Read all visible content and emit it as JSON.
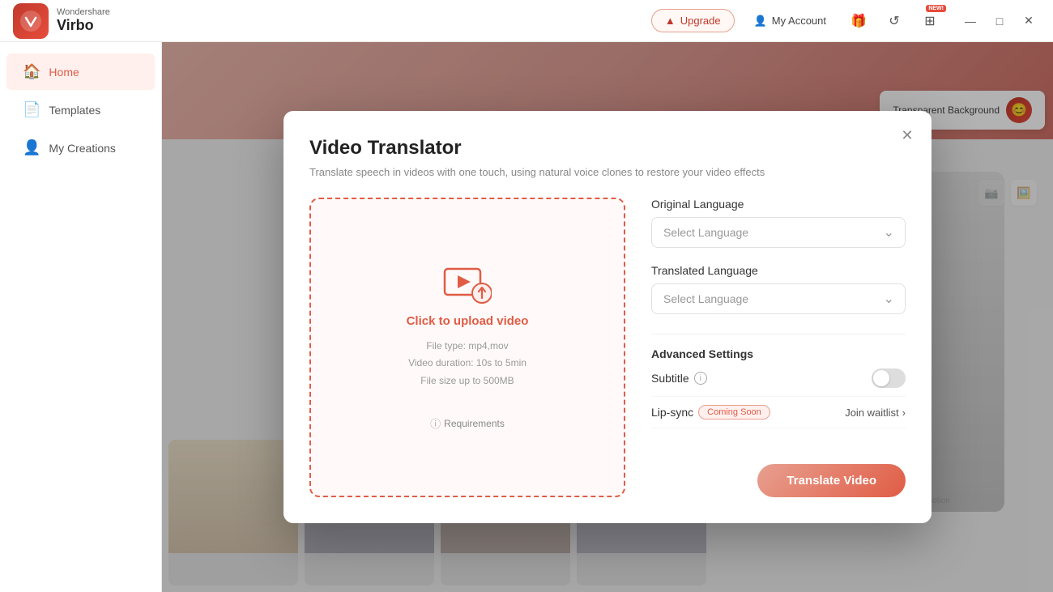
{
  "app": {
    "brand": "Wondershare",
    "product": "Virbo",
    "logo_char": "V"
  },
  "titlebar": {
    "upgrade_label": "Upgrade",
    "my_account_label": "My Account",
    "new_badge": "NEW!",
    "minimize_char": "—",
    "maximize_char": "□",
    "close_char": "✕"
  },
  "sidebar": {
    "items": [
      {
        "id": "home",
        "label": "Home",
        "icon": "🏠",
        "active": true
      },
      {
        "id": "templates",
        "label": "Templates",
        "icon": "📄"
      },
      {
        "id": "my-creations",
        "label": "My Creations",
        "icon": "👤"
      }
    ]
  },
  "background": {
    "transparent_bg_label": "Transparent Background",
    "promo_label": "Super-Promotion"
  },
  "modal": {
    "title": "Video Translator",
    "subtitle": "Translate speech in videos with one touch, using natural voice clones to restore your video effects",
    "close_icon": "✕",
    "upload": {
      "click_to_upload": "Click to upload video",
      "file_type_label": "File type: mp4,mov",
      "video_duration_label": "Video duration: 10s to 5min",
      "file_size_label": "File size up to  500MB",
      "requirements_label": "Requirements"
    },
    "original_language": {
      "label": "Original Language",
      "placeholder": "Select Language",
      "chevron": "⌄"
    },
    "translated_language": {
      "label": "Translated Language",
      "placeholder": "Select Language",
      "chevron": "⌄"
    },
    "advanced_settings": {
      "label": "Advanced Settings",
      "subtitle_label": "Subtitle",
      "lipsync_label": "Lip-sync",
      "coming_soon": "Coming Soon",
      "join_waitlist": "Join waitlist",
      "join_chevron": "›"
    },
    "translate_button": "Translate Video"
  },
  "colors": {
    "primary": "#e05c45",
    "primary_light": "#fff0ee",
    "border": "#e0e0e0"
  }
}
